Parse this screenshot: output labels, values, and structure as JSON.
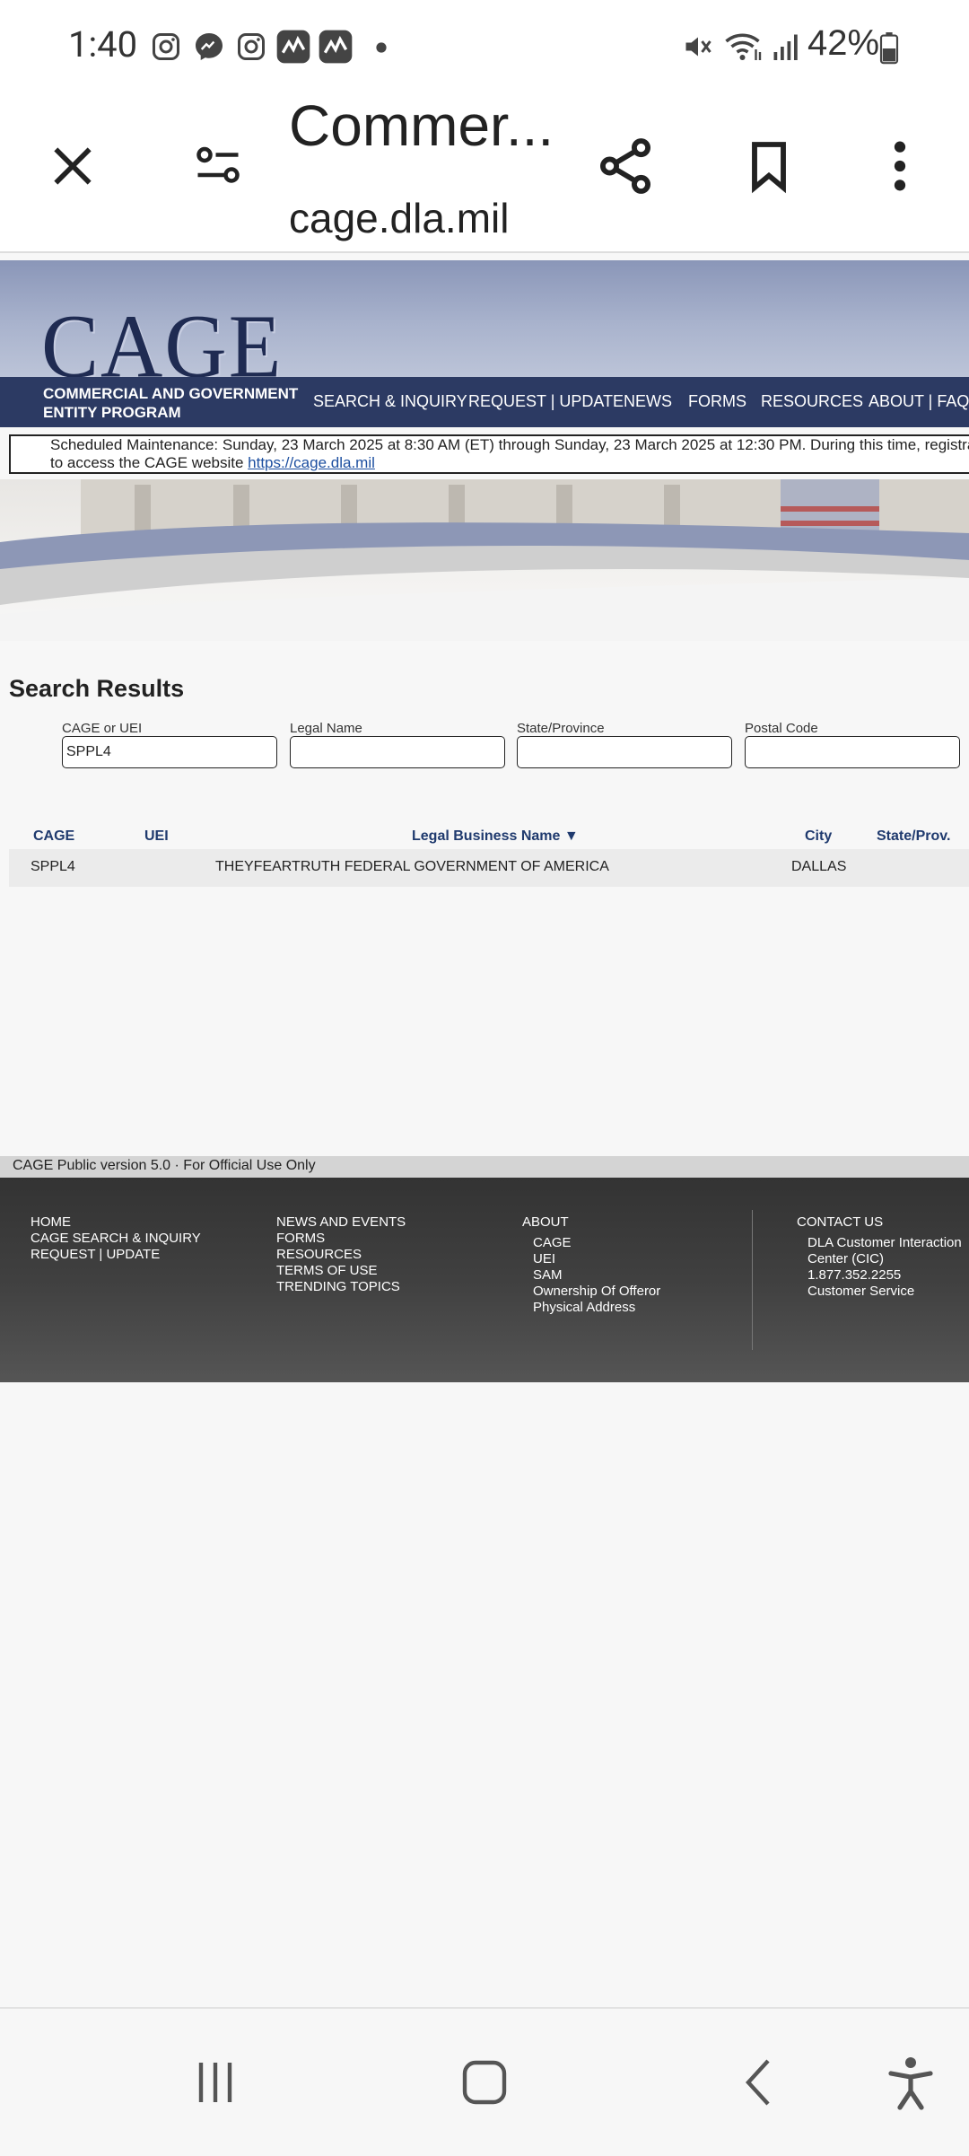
{
  "status_bar": {
    "time": "1:40",
    "battery": "42%",
    "icons": [
      "instagram-icon",
      "messenger-icon",
      "instagram-icon",
      "app-icon",
      "app-icon",
      "dot-icon",
      "mute-icon",
      "wifi-icon",
      "signal-icon",
      "battery-icon"
    ]
  },
  "browser": {
    "title": "Commer...",
    "url": "cage.dla.mil"
  },
  "site": {
    "logo": "CAGE",
    "brand": "COMMERCIAL AND GOVERNMENT ENTITY PROGRAM",
    "nav": [
      "SEARCH & INQUIRY",
      "REQUEST | UPDATE",
      "NEWS",
      "FORMS",
      "RESOURCES",
      "ABOUT | FAQ"
    ],
    "maintenance_text": "Scheduled Maintenance: Sunday, 23 March 2025 at 8:30 AM (ET) through Sunday, 23 March 2025 at 12:30 PM. During this time, registra",
    "maintenance_text2": "to access the CAGE website ",
    "maintenance_link": "https://cage.dla.mil"
  },
  "search": {
    "title": "Search Results",
    "fields": [
      {
        "label": "CAGE or UEI",
        "value": "SPPL4"
      },
      {
        "label": "Legal Name",
        "value": ""
      },
      {
        "label": "State/Province",
        "value": ""
      },
      {
        "label": "Postal Code",
        "value": ""
      }
    ]
  },
  "results": {
    "headers": [
      "CAGE",
      "UEI",
      "Legal Business Name ▼",
      "City",
      "State/Prov."
    ],
    "rows": [
      {
        "cage": "SPPL4",
        "uei": "",
        "name": "THEYFEARTRUTH FEDERAL GOVERNMENT OF AMERICA",
        "city": "DALLAS",
        "state": ""
      }
    ]
  },
  "footer": {
    "version": "CAGE Public version 5.0 · For Official Use Only",
    "col1": [
      "HOME",
      "CAGE SEARCH & INQUIRY",
      "REQUEST | UPDATE"
    ],
    "col2": [
      "NEWS AND EVENTS",
      "FORMS",
      "RESOURCES",
      "TERMS OF USE",
      "TRENDING TOPICS"
    ],
    "col3_title": "ABOUT",
    "col3": [
      "CAGE",
      "UEI",
      "SAM",
      "Ownership Of Offeror",
      "Physical Address"
    ],
    "col4_title": "CONTACT US",
    "col4": [
      "DLA Customer Interaction",
      "Center (CIC)",
      "1.877.352.2255",
      "Customer Service"
    ]
  }
}
